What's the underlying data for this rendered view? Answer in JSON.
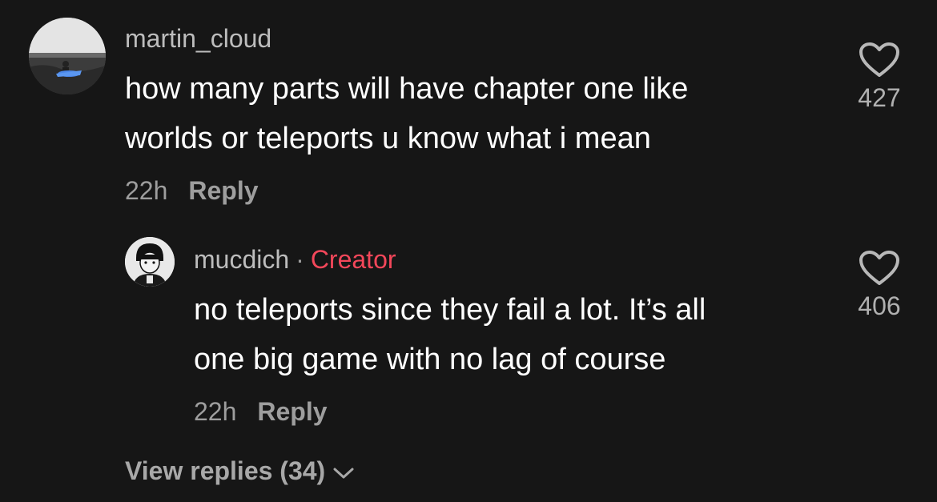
{
  "comment": {
    "username": "martin_cloud",
    "text": "how many parts will have chapter one like\nworlds or teleports u know what i mean",
    "time": "22h",
    "reply_label": "Reply",
    "like_count": "427",
    "like_icon": "heart-outline-icon"
  },
  "reply": {
    "username": "mucdich",
    "separator": "·",
    "badge": "Creator",
    "badge_color": "#f3475a",
    "text": "no teleports since they fail a lot. It’s all\none big game with no lag of course",
    "time": "22h",
    "reply_label": "Reply",
    "like_count": "406",
    "like_icon": "heart-outline-icon"
  },
  "view_replies": {
    "label": "View replies (34)",
    "icon": "chevron-down-icon"
  },
  "colors": {
    "background": "#161616",
    "text_primary": "#ffffff",
    "text_secondary": "#9e9e9e"
  }
}
